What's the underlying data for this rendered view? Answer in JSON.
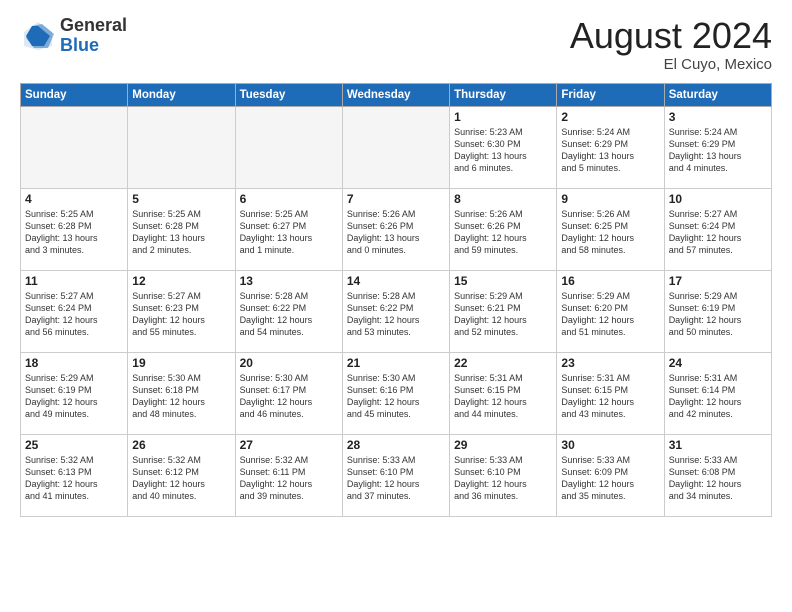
{
  "header": {
    "logo_general": "General",
    "logo_blue": "Blue",
    "month_year": "August 2024",
    "location": "El Cuyo, Mexico"
  },
  "days_of_week": [
    "Sunday",
    "Monday",
    "Tuesday",
    "Wednesday",
    "Thursday",
    "Friday",
    "Saturday"
  ],
  "weeks": [
    [
      {
        "day": "",
        "info": ""
      },
      {
        "day": "",
        "info": ""
      },
      {
        "day": "",
        "info": ""
      },
      {
        "day": "",
        "info": ""
      },
      {
        "day": "1",
        "info": "Sunrise: 5:23 AM\nSunset: 6:30 PM\nDaylight: 13 hours\nand 6 minutes."
      },
      {
        "day": "2",
        "info": "Sunrise: 5:24 AM\nSunset: 6:29 PM\nDaylight: 13 hours\nand 5 minutes."
      },
      {
        "day": "3",
        "info": "Sunrise: 5:24 AM\nSunset: 6:29 PM\nDaylight: 13 hours\nand 4 minutes."
      }
    ],
    [
      {
        "day": "4",
        "info": "Sunrise: 5:25 AM\nSunset: 6:28 PM\nDaylight: 13 hours\nand 3 minutes."
      },
      {
        "day": "5",
        "info": "Sunrise: 5:25 AM\nSunset: 6:28 PM\nDaylight: 13 hours\nand 2 minutes."
      },
      {
        "day": "6",
        "info": "Sunrise: 5:25 AM\nSunset: 6:27 PM\nDaylight: 13 hours\nand 1 minute."
      },
      {
        "day": "7",
        "info": "Sunrise: 5:26 AM\nSunset: 6:26 PM\nDaylight: 13 hours\nand 0 minutes."
      },
      {
        "day": "8",
        "info": "Sunrise: 5:26 AM\nSunset: 6:26 PM\nDaylight: 12 hours\nand 59 minutes."
      },
      {
        "day": "9",
        "info": "Sunrise: 5:26 AM\nSunset: 6:25 PM\nDaylight: 12 hours\nand 58 minutes."
      },
      {
        "day": "10",
        "info": "Sunrise: 5:27 AM\nSunset: 6:24 PM\nDaylight: 12 hours\nand 57 minutes."
      }
    ],
    [
      {
        "day": "11",
        "info": "Sunrise: 5:27 AM\nSunset: 6:24 PM\nDaylight: 12 hours\nand 56 minutes."
      },
      {
        "day": "12",
        "info": "Sunrise: 5:27 AM\nSunset: 6:23 PM\nDaylight: 12 hours\nand 55 minutes."
      },
      {
        "day": "13",
        "info": "Sunrise: 5:28 AM\nSunset: 6:22 PM\nDaylight: 12 hours\nand 54 minutes."
      },
      {
        "day": "14",
        "info": "Sunrise: 5:28 AM\nSunset: 6:22 PM\nDaylight: 12 hours\nand 53 minutes."
      },
      {
        "day": "15",
        "info": "Sunrise: 5:29 AM\nSunset: 6:21 PM\nDaylight: 12 hours\nand 52 minutes."
      },
      {
        "day": "16",
        "info": "Sunrise: 5:29 AM\nSunset: 6:20 PM\nDaylight: 12 hours\nand 51 minutes."
      },
      {
        "day": "17",
        "info": "Sunrise: 5:29 AM\nSunset: 6:19 PM\nDaylight: 12 hours\nand 50 minutes."
      }
    ],
    [
      {
        "day": "18",
        "info": "Sunrise: 5:29 AM\nSunset: 6:19 PM\nDaylight: 12 hours\nand 49 minutes."
      },
      {
        "day": "19",
        "info": "Sunrise: 5:30 AM\nSunset: 6:18 PM\nDaylight: 12 hours\nand 48 minutes."
      },
      {
        "day": "20",
        "info": "Sunrise: 5:30 AM\nSunset: 6:17 PM\nDaylight: 12 hours\nand 46 minutes."
      },
      {
        "day": "21",
        "info": "Sunrise: 5:30 AM\nSunset: 6:16 PM\nDaylight: 12 hours\nand 45 minutes."
      },
      {
        "day": "22",
        "info": "Sunrise: 5:31 AM\nSunset: 6:15 PM\nDaylight: 12 hours\nand 44 minutes."
      },
      {
        "day": "23",
        "info": "Sunrise: 5:31 AM\nSunset: 6:15 PM\nDaylight: 12 hours\nand 43 minutes."
      },
      {
        "day": "24",
        "info": "Sunrise: 5:31 AM\nSunset: 6:14 PM\nDaylight: 12 hours\nand 42 minutes."
      }
    ],
    [
      {
        "day": "25",
        "info": "Sunrise: 5:32 AM\nSunset: 6:13 PM\nDaylight: 12 hours\nand 41 minutes."
      },
      {
        "day": "26",
        "info": "Sunrise: 5:32 AM\nSunset: 6:12 PM\nDaylight: 12 hours\nand 40 minutes."
      },
      {
        "day": "27",
        "info": "Sunrise: 5:32 AM\nSunset: 6:11 PM\nDaylight: 12 hours\nand 39 minutes."
      },
      {
        "day": "28",
        "info": "Sunrise: 5:33 AM\nSunset: 6:10 PM\nDaylight: 12 hours\nand 37 minutes."
      },
      {
        "day": "29",
        "info": "Sunrise: 5:33 AM\nSunset: 6:10 PM\nDaylight: 12 hours\nand 36 minutes."
      },
      {
        "day": "30",
        "info": "Sunrise: 5:33 AM\nSunset: 6:09 PM\nDaylight: 12 hours\nand 35 minutes."
      },
      {
        "day": "31",
        "info": "Sunrise: 5:33 AM\nSunset: 6:08 PM\nDaylight: 12 hours\nand 34 minutes."
      }
    ]
  ]
}
